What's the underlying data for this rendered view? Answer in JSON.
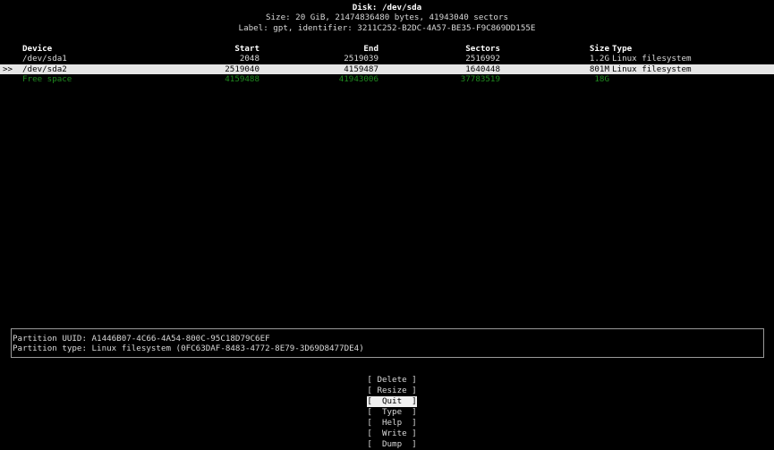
{
  "header": {
    "disk": "Disk: /dev/sda",
    "size": "Size: 20 GiB, 21474836480 bytes, 41943040 sectors",
    "label": "Label: gpt, identifier: 3211C252-B2DC-4A57-BE35-F9C869DD155E"
  },
  "table": {
    "columns": {
      "device": "Device",
      "start": "Start",
      "end": "End",
      "sectors": "Sectors",
      "size": "Size",
      "type": "Type"
    },
    "rows": [
      {
        "marker": "",
        "device": "/dev/sda1",
        "start": "2048",
        "end": "2519039",
        "sectors": "2516992",
        "size": "1.2G",
        "type": "Linux filesystem"
      },
      {
        "marker": ">>",
        "device": "/dev/sda2",
        "start": "2519040",
        "end": "4159487",
        "sectors": "1640448",
        "size": "801M",
        "type": "Linux filesystem"
      },
      {
        "marker": "",
        "device": "Free space",
        "start": "4159488",
        "end": "41943006",
        "sectors": "37783519",
        "size": "18G",
        "type": ""
      }
    ]
  },
  "info": {
    "uuid": "Partition UUID: A1446B07-4C66-4A54-800C-95C18D79C6EF",
    "type": "Partition type: Linux filesystem (0FC63DAF-8483-4772-8E79-3D69D8477DE4)"
  },
  "menu": [
    "[ Delete ]",
    "[ Resize ]",
    "[  Quit  ]",
    "[  Type  ]",
    "[  Help  ]",
    "[  Write ]",
    "[  Dump  ]"
  ],
  "colors": {
    "free_space": "#1f8a1f",
    "selected_bg": "#e6e6e6"
  }
}
